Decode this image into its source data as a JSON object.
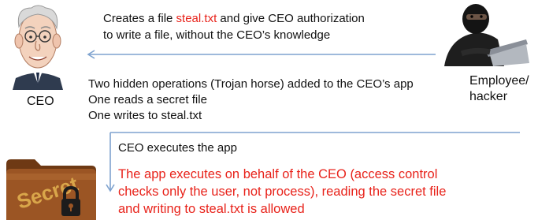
{
  "actors": {
    "ceo": {
      "label": "CEO"
    },
    "hacker": {
      "label_line1": "Employee/",
      "label_line2": "hacker"
    }
  },
  "step1": {
    "line1_prefix": "Creates a file ",
    "line1_highlight": "steal.txt",
    "line1_suffix": " and give CEO authorization",
    "line2": "to write a file, without the CEO’s knowledge"
  },
  "step2": {
    "line1": "Two hidden operations (Trojan horse) added to the CEO’s app",
    "line2": "One reads a secret file",
    "line3": "One writes to steal.txt"
  },
  "step3": {
    "label": "CEO executes the app"
  },
  "conclusion": {
    "line1": "The app executes on behalf of the CEO (access control",
    "line2": "checks only the user, not process), reading the secret file",
    "line3": "and writing to steal.txt is allowed"
  },
  "folder": {
    "label": "Secret"
  },
  "colors": {
    "highlight": "#e8221a",
    "arrow": "#7ea2cf",
    "folder": "#8a4a1c"
  }
}
